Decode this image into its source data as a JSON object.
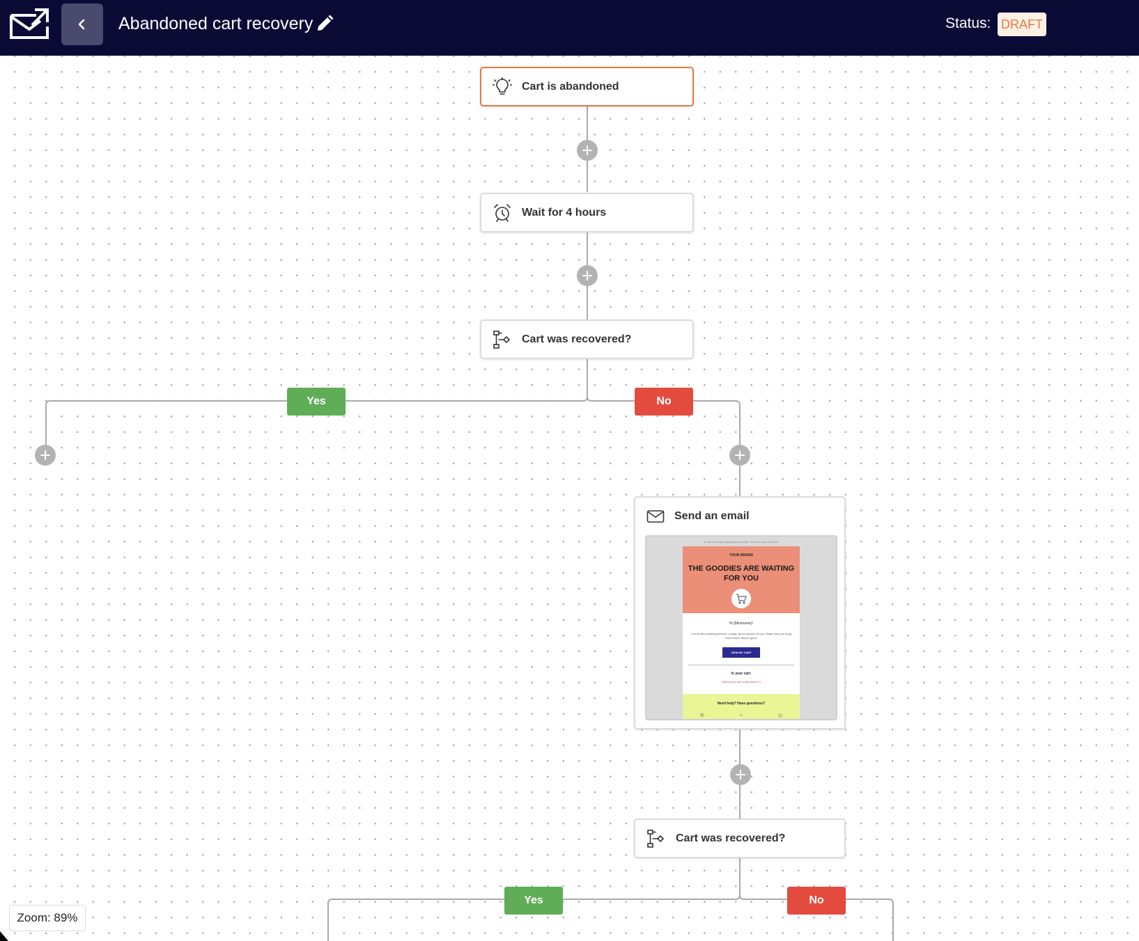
{
  "app": {
    "title": "Abandoned cart recovery",
    "status_label": "Status:",
    "status_value": "DRAFT"
  },
  "colors": {
    "topbar": "#0b0a35",
    "accent_orange": "#e8773f",
    "yes_green": "#5fad56",
    "no_red": "#e34b3f"
  },
  "nodes": {
    "trigger": {
      "label": "Cart is abandoned",
      "icon": "lightbulb-icon"
    },
    "wait": {
      "label": "Wait for 4 hours",
      "icon": "alarm-clock-icon"
    },
    "condition1": {
      "label": "Cart was recovered?",
      "icon": "condition-icon"
    },
    "email": {
      "label": "Send an email",
      "icon": "envelope-icon",
      "preview": {
        "pre_header": "Is this email not displaying correctly? View it in your browser.",
        "brand": "YOUR BRAND",
        "headline": "THE GOODIES ARE WAITING FOR YOU",
        "greeting": "Hi {$firstname}!",
        "copy": "You've left something behind. Luckily, we've saved it for you. Make sure you snag them before they're gone!",
        "cta": "VIEW MY CART",
        "in_cart": "In your cart:",
        "script_note": "Abandoned cart script (block X)",
        "help": "Need help? Have questions?"
      }
    },
    "condition2": {
      "label": "Cart was recovered?",
      "icon": "condition-icon"
    }
  },
  "branches": {
    "yes": "Yes",
    "no": "No"
  },
  "zoom": "Zoom: 89%"
}
